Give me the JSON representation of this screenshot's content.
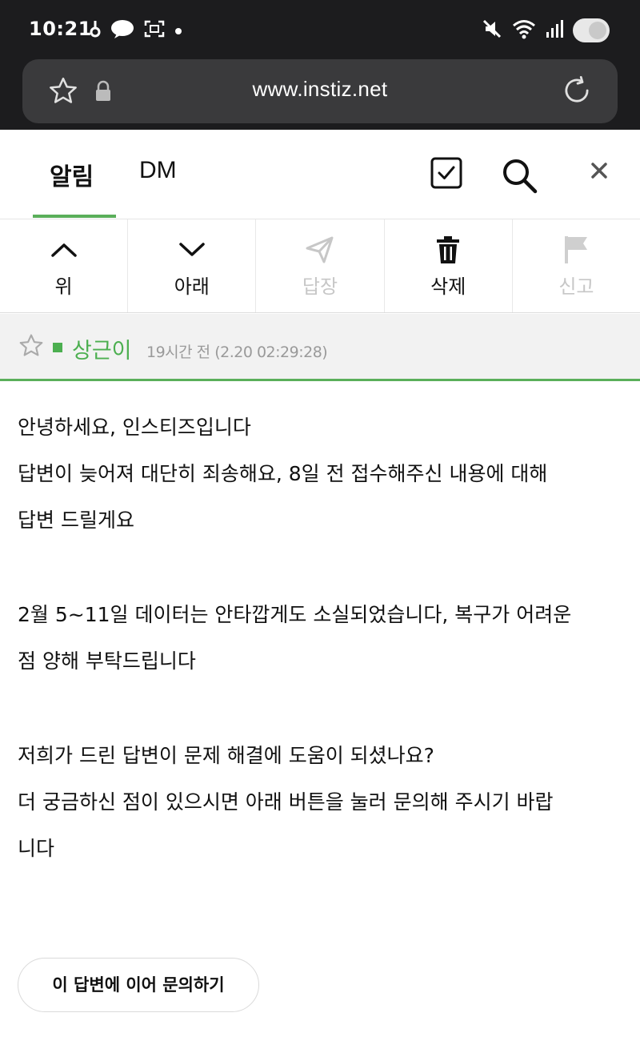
{
  "status_bar": {
    "time": "10:21",
    "left_icons": [
      "notification-app-icon",
      "chat-bubble-icon",
      "screen-capture-icon",
      "dot-icon"
    ],
    "right_icons": [
      "mute-icon",
      "wifi-icon",
      "signal-icon",
      "battery-icon"
    ]
  },
  "browser": {
    "url": "www.instiz.net",
    "icons": [
      "star-icon",
      "lock-icon",
      "reload-icon"
    ]
  },
  "tabs": [
    {
      "label": "알림",
      "active": true
    },
    {
      "label": "DM",
      "active": false
    }
  ],
  "header_icons": [
    "checkbox-icon",
    "search-icon",
    "close-icon"
  ],
  "toolbar": [
    {
      "label": "위",
      "icon": "chevron-up-icon",
      "disabled": false
    },
    {
      "label": "아래",
      "icon": "chevron-down-icon",
      "disabled": false
    },
    {
      "label": "답장",
      "icon": "send-icon",
      "disabled": true
    },
    {
      "label": "삭제",
      "icon": "trash-icon",
      "disabled": false
    },
    {
      "label": "신고",
      "icon": "flag-icon",
      "disabled": true
    }
  ],
  "message": {
    "sender": "상근이",
    "time": "19시간 전 (2.20 02:29:28)",
    "lines": [
      "안녕하세요, 인스티즈입니다",
      "답변이 늦어져 대단히 죄송해요, 8일 전 접수해주신 내용에 대해",
      "답변 드릴게요",
      "",
      "2월 5~11일 데이터는 안타깝게도 소실되었습니다, 복구가 어려운",
      "점 양해 부탁드립니다",
      "",
      "저희가 드린 답변이 문제 해결에 도움이 되셨나요?",
      "더 궁금하신 점이 있으시면 아래 버튼을 눌러 문의해 주시기 바랍",
      "니다"
    ]
  },
  "followup_button": "이 답변에 이어 문의하기",
  "colors": {
    "accent_green": "#4caf50",
    "dark_chrome": "#1c1c1e",
    "disabled_gray": "#c7c7c7"
  }
}
